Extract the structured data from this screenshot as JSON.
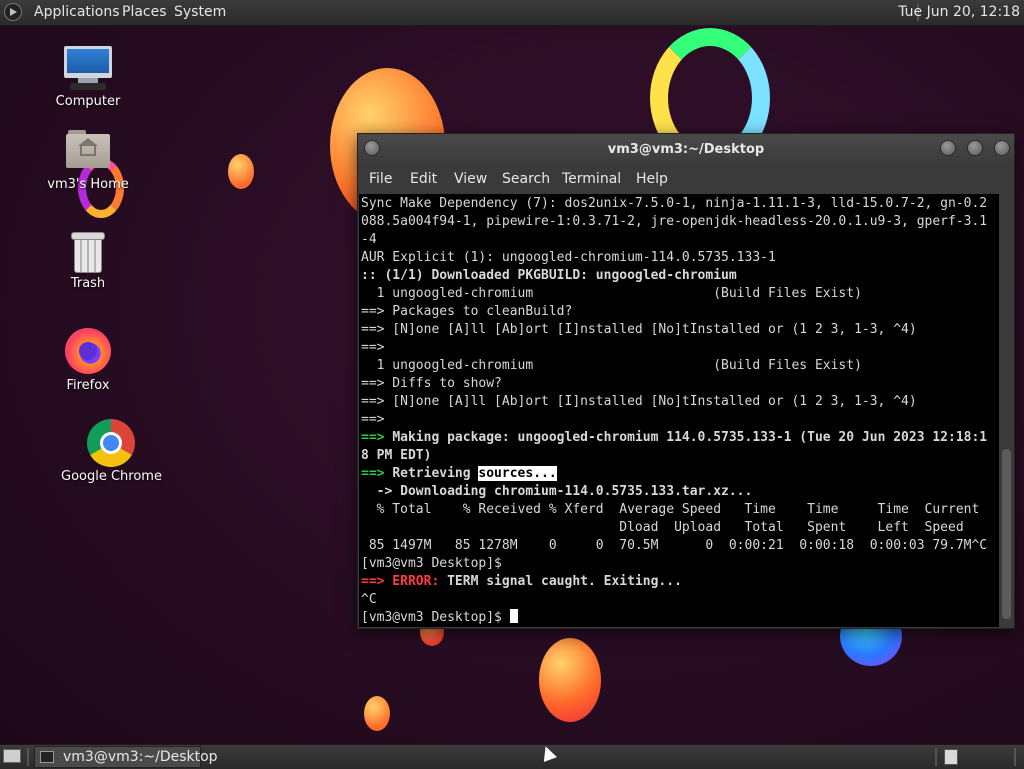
{
  "top_panel": {
    "menus": [
      "Applications",
      "Places",
      "System"
    ],
    "clock": "Tue Jun 20, 12:18"
  },
  "desktop": {
    "icons": [
      {
        "label": "Computer",
        "icon": "computer-icon"
      },
      {
        "label": "vm3's Home",
        "icon": "home-folder-icon"
      },
      {
        "label": "Trash",
        "icon": "trash-icon"
      },
      {
        "label": "Firefox",
        "icon": "firefox-icon"
      },
      {
        "label": "Google Chrome",
        "icon": "chrome-icon"
      }
    ]
  },
  "terminal": {
    "title": "vm3@vm3:~/Desktop",
    "menu": [
      "File",
      "Edit",
      "View",
      "Search",
      "Terminal",
      "Help"
    ],
    "lines": [
      {
        "segments": [
          {
            "t": "Sync Make Dependency (7): dos2unix-7.5.0-1, ninja-1.11.1-3, lld-15.0.7-2, gn-0.2",
            "s": ""
          }
        ]
      },
      {
        "segments": [
          {
            "t": "088.5a004f94-1, pipewire-1:0.3.71-2, jre-openjdk-headless-20.0.1.u9-3, gperf-3.1",
            "s": ""
          }
        ]
      },
      {
        "segments": [
          {
            "t": "-4",
            "s": ""
          }
        ]
      },
      {
        "segments": [
          {
            "t": "AUR Explicit (1): ungoogled-chromium-114.0.5735.133-1",
            "s": ""
          }
        ]
      },
      {
        "segments": [
          {
            "t": ":: (1/1) Downloaded PKGBUILD: ungoogled-chromium",
            "s": "bold"
          }
        ]
      },
      {
        "segments": [
          {
            "t": "  1 ungoogled-chromium                       (Build Files Exist)",
            "s": ""
          }
        ]
      },
      {
        "segments": [
          {
            "t": "==> Packages to cleanBuild?",
            "s": ""
          }
        ]
      },
      {
        "segments": [
          {
            "t": "==> [N]one [A]ll [Ab]ort [I]nstalled [No]tInstalled or (1 2 3, 1-3, ^4)",
            "s": ""
          }
        ]
      },
      {
        "segments": [
          {
            "t": "==>",
            "s": ""
          }
        ]
      },
      {
        "segments": [
          {
            "t": "  1 ungoogled-chromium                       (Build Files Exist)",
            "s": ""
          }
        ]
      },
      {
        "segments": [
          {
            "t": "==> Diffs to show?",
            "s": ""
          }
        ]
      },
      {
        "segments": [
          {
            "t": "==> [N]one [A]ll [Ab]ort [I]nstalled [No]tInstalled or (1 2 3, 1-3, ^4)",
            "s": ""
          }
        ]
      },
      {
        "segments": [
          {
            "t": "==>",
            "s": ""
          }
        ]
      },
      {
        "segments": [
          {
            "t": "==> ",
            "s": "g"
          },
          {
            "t": "Making package: ungoogled-chromium 114.0.5735.133-1 (Tue 20 Jun 2023 12:18:1",
            "s": "bold"
          }
        ]
      },
      {
        "segments": [
          {
            "t": "8 PM EDT)",
            "s": "bold"
          }
        ]
      },
      {
        "segments": [
          {
            "t": "==> ",
            "s": "g"
          },
          {
            "t": "Retrieving ",
            "s": "bold"
          },
          {
            "t": "sources...",
            "s": "inv"
          }
        ]
      },
      {
        "segments": [
          {
            "t": "  -> Downloading chromium-114.0.5735.133.tar.xz...",
            "s": "bold"
          }
        ]
      },
      {
        "segments": [
          {
            "t": "  % Total    % Received % Xferd  Average Speed   Time    Time     Time  Current",
            "s": ""
          }
        ]
      },
      {
        "segments": [
          {
            "t": "                                 Dload  Upload   Total   Spent    Left  Speed",
            "s": ""
          }
        ]
      },
      {
        "segments": [
          {
            "t": " 85 1497M   85 1278M    0     0  70.5M      0  0:00:21  0:00:18  0:00:03 79.7M^C",
            "s": ""
          }
        ]
      },
      {
        "segments": [
          {
            "t": "[vm3@vm3 Desktop]$",
            "s": ""
          }
        ]
      },
      {
        "segments": [
          {
            "t": "==> ERROR: ",
            "s": "r"
          },
          {
            "t": "TERM signal caught. Exiting...",
            "s": "bold"
          }
        ]
      },
      {
        "segments": [
          {
            "t": "^C",
            "s": ""
          }
        ]
      },
      {
        "segments": [
          {
            "t": "[vm3@vm3 Desktop]$ ",
            "s": ""
          }
        ]
      }
    ]
  },
  "bottom_panel": {
    "tasks": [
      {
        "label": "vm3@vm3:~/Desktop"
      }
    ]
  }
}
